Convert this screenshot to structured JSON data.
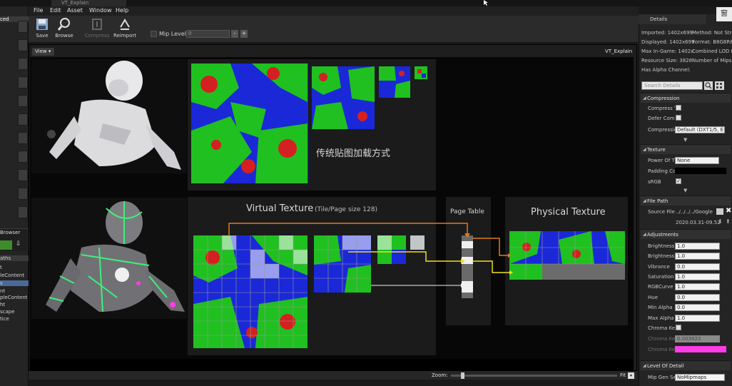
{
  "window": {
    "tab_title": "VT_Explain"
  },
  "menu": [
    "File",
    "Edit",
    "Asset",
    "Window",
    "Help"
  ],
  "toolbar": {
    "save": "Save",
    "browse": "Browse",
    "compress": "Compress",
    "reimport": "Reimport",
    "mip_level_label": "Mip Level:",
    "mip_level_value": "0",
    "minus": "-",
    "plus": "+"
  },
  "left_panel": {
    "top_label": "ced",
    "browser_label": "Browser",
    "paths_label": "aths",
    "items": [
      "t",
      "leContent",
      "s",
      "nt",
      "pleContent",
      "ht",
      "scape",
      "tice"
    ]
  },
  "viewport": {
    "view_button": "View",
    "asset_label": "VT_Explain",
    "zoom_label": "Zoom:",
    "fit_label": "Fit"
  },
  "slide": {
    "traditional_caption": "传统贴图加载方式",
    "vt_title": "Virtual Texture",
    "vt_subtitle": "(Tile/Page size 128)",
    "page_table_title": "Page Table",
    "physical_title": "Physical Texture"
  },
  "details": {
    "tab_label": "Details",
    "corner_label": "窗",
    "info": [
      "Imported: 1402x699",
      "Displayed: 1402x699",
      "Max In-Game: 1402x",
      "Resource Size: 3828",
      "Has Alpha Channel:"
    ],
    "info_right": [
      "Method: Not Stre",
      "Format: B8G8R8A",
      "Combined LOD B",
      "Number of Mips:"
    ],
    "search_placeholder": "Search Details",
    "sections": {
      "compression": "Compression",
      "texture": "Texture",
      "file_path": "File Path",
      "adjustments": "Adjustments",
      "lod": "Level Of Detail"
    },
    "compression": {
      "compress_label": "Compress V",
      "defer_label": "Defer Comp",
      "settings_label": "Compressio",
      "settings_value": "Default (DXT1/5, E"
    },
    "texture": {
      "power_label": "Power Of Tv",
      "power_value": "None",
      "padding_label": "Padding Co",
      "srgb_label": "sRGB"
    },
    "file_path": {
      "source_label": "Source File",
      "source_value": "../../../../Google",
      "date": "2020.03.31-09.52.2"
    },
    "adjustments": [
      {
        "label": "Brightness",
        "value": "1.0",
        "dim": false
      },
      {
        "label": "Brightness I",
        "value": "1.0",
        "dim": false
      },
      {
        "label": "Vibrance",
        "value": "0.0",
        "dim": false
      },
      {
        "label": "Saturation",
        "value": "1.0",
        "dim": false
      },
      {
        "label": "RGBCurve",
        "value": "1.0",
        "dim": false
      },
      {
        "label": "Hue",
        "value": "0.0",
        "dim": false
      },
      {
        "label": "Min Alpha",
        "value": "0.0",
        "dim": false
      },
      {
        "label": "Max Alpha",
        "value": "1.0",
        "dim": false
      }
    ],
    "chroma_key_label": "Chroma Key",
    "chroma_thresh_label": "Chroma Key",
    "chroma_thresh_value": "0.003922",
    "chroma_color_label": "Chroma Key",
    "chroma_color": "#ff3ce8",
    "lod_first_label": "Mip Gen Se",
    "lod_first_value": "NoMipmaps"
  },
  "colors": {
    "accent_green": "#1ec81e",
    "accent_red": "#d21e1e",
    "accent_blue": "#1e2ad2",
    "arrow_orange": "#e07a1e",
    "arrow_yellow": "#f0e020",
    "arrow_white": "#f0f0f0"
  }
}
